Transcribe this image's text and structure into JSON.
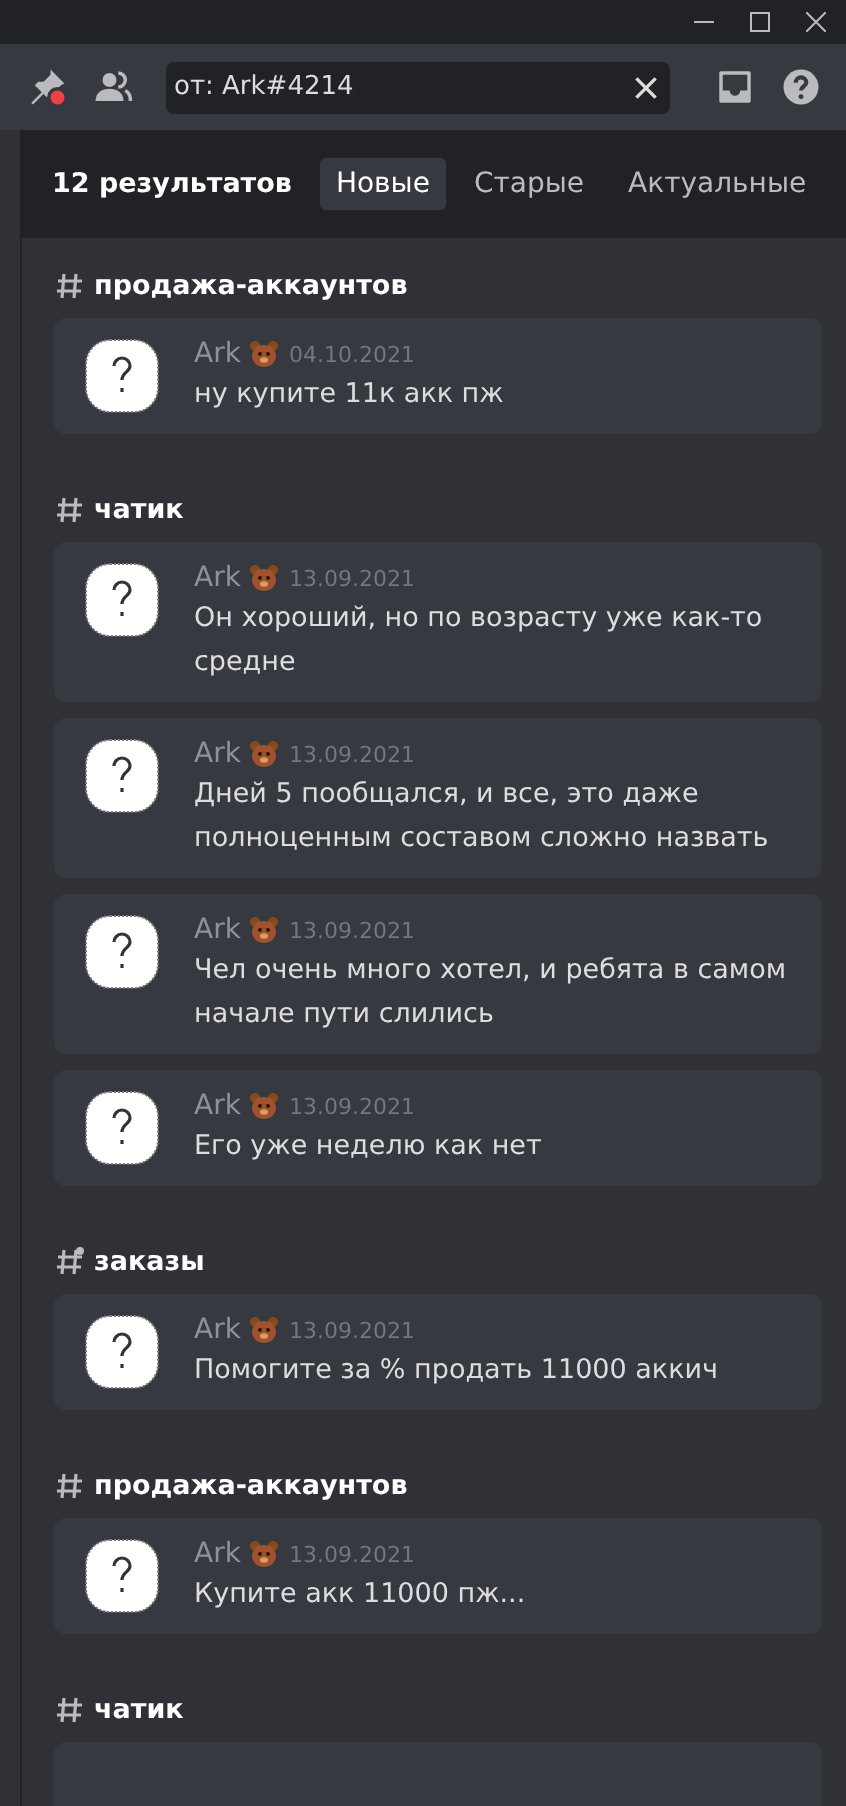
{
  "search": {
    "value": "от: Ark#4214"
  },
  "results": {
    "count": "12 результатов",
    "tabs": [
      {
        "label": "Новые",
        "selected": true
      },
      {
        "label": "Старые",
        "selected": false
      },
      {
        "label": "Актуальные",
        "selected": false
      }
    ]
  },
  "groups": [
    {
      "channel": "продажа-аккаунтов",
      "kind": "hash",
      "messages": [
        {
          "author": "Ark",
          "date": "04.10.2021",
          "text": "ну купите 11к акк пж"
        }
      ]
    },
    {
      "channel": "чатик",
      "kind": "hash",
      "messages": [
        {
          "author": "Ark",
          "date": "13.09.2021",
          "text": "Он хороший, но по возрасту уже как-то средне"
        },
        {
          "author": "Ark",
          "date": "13.09.2021",
          "text": "Дней 5 пообщался, и все, это даже полноценным составом сложно назвать"
        },
        {
          "author": "Ark",
          "date": "13.09.2021",
          "text": "Чел очень много хотел, и ребята в самом начале пути слились"
        },
        {
          "author": "Ark",
          "date": "13.09.2021",
          "text": "Его уже неделю как нет"
        }
      ]
    },
    {
      "channel": "заказы",
      "kind": "hash-dot",
      "messages": [
        {
          "author": "Ark",
          "date": "13.09.2021",
          "text": "Помогите за % продать 11000 аккич"
        }
      ]
    },
    {
      "channel": "продажа-аккаунтов",
      "kind": "hash",
      "messages": [
        {
          "author": "Ark",
          "date": "13.09.2021",
          "text": "Купите акк 11000 пж..."
        }
      ]
    },
    {
      "channel": "чатик",
      "kind": "hash"
    }
  ]
}
